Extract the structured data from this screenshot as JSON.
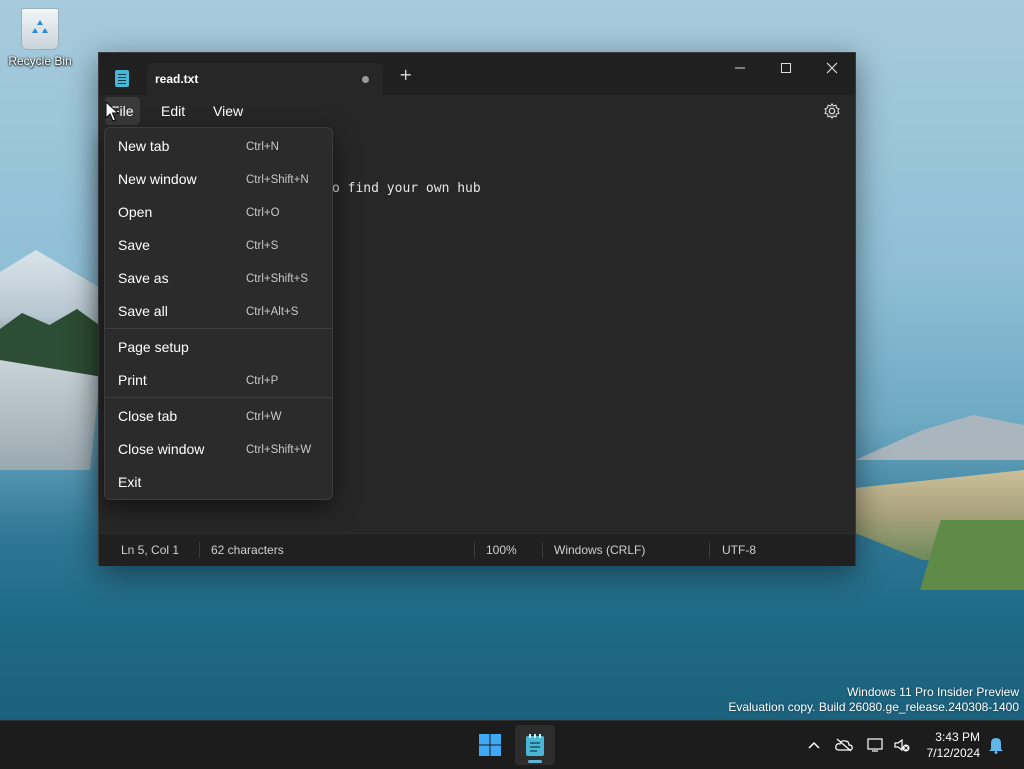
{
  "desktop": {
    "recycle_bin_label": "Recycle Bin",
    "watermark_line1": "Windows 11 Pro Insider Preview",
    "watermark_line2": "Evaluation copy. Build 26080.ge_release.240308-1400"
  },
  "window": {
    "tab_title": "read.txt",
    "tab_modified": true,
    "menu": [
      "File",
      "Edit",
      "View"
    ],
    "visible_text": "o find your own hub"
  },
  "file_menu": {
    "items": [
      {
        "label": "New tab",
        "shortcut": "Ctrl+N"
      },
      {
        "label": "New window",
        "shortcut": "Ctrl+Shift+N"
      },
      {
        "label": "Open",
        "shortcut": "Ctrl+O"
      },
      {
        "label": "Save",
        "shortcut": "Ctrl+S"
      },
      {
        "label": "Save as",
        "shortcut": "Ctrl+Shift+S"
      },
      {
        "label": "Save all",
        "shortcut": "Ctrl+Alt+S"
      },
      {
        "label": "Page setup",
        "shortcut": ""
      },
      {
        "label": "Print",
        "shortcut": "Ctrl+P"
      },
      {
        "label": "Close tab",
        "shortcut": "Ctrl+W"
      },
      {
        "label": "Close window",
        "shortcut": "Ctrl+Shift+W"
      },
      {
        "label": "Exit",
        "shortcut": ""
      }
    ]
  },
  "statusbar": {
    "position": "Ln 5, Col 1",
    "characters": "62 characters",
    "zoom": "100%",
    "line_ending": "Windows (CRLF)",
    "encoding": "UTF-8"
  },
  "taskbar": {
    "time": "3:43 PM",
    "date": "7/12/2024"
  },
  "colors": {
    "accent": "#49b6d6",
    "window_bg": "#272727",
    "titlebar_bg": "#202020",
    "taskbar_bg": "#1c1c1c"
  }
}
